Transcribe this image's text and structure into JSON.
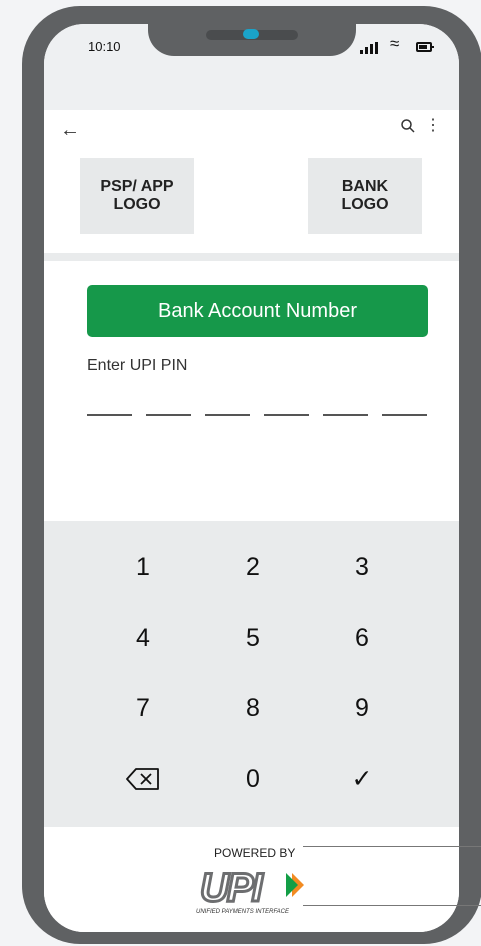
{
  "status_bar": {
    "time": "10:10"
  },
  "toolbar": {},
  "logos": {
    "psp_line1": "PSP/ APP",
    "psp_line2": "LOGO",
    "bank_line1": "BANK",
    "bank_line2": "LOGO"
  },
  "account": {
    "label": "Bank Account Number"
  },
  "pin": {
    "label": "Enter UPI PIN",
    "length": 6
  },
  "keypad": {
    "k1": "1",
    "k2": "2",
    "k3": "3",
    "k4": "4",
    "k5": "5",
    "k6": "6",
    "k7": "7",
    "k8": "8",
    "k9": "9",
    "k0": "0",
    "backspace": "⌫",
    "confirm": "✓"
  },
  "footer": {
    "powered_by": "POWERED BY",
    "logo_text": "UPI",
    "tagline": "UNIFIED PAYMENTS INTERFACE"
  },
  "colors": {
    "accent": "#16984a",
    "keypad_bg": "#e9ebec",
    "frame": "#5f6163"
  }
}
